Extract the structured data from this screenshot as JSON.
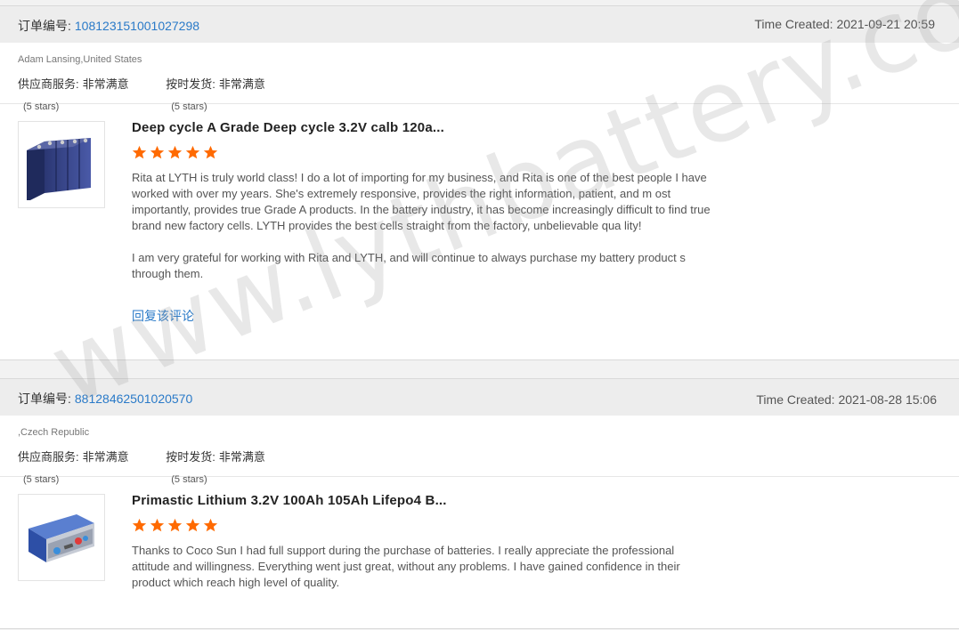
{
  "reviews": [
    {
      "order_label": "订单编号:",
      "order_number": "108123151001027298",
      "time_created": "Time Created: 2021-09-21 20:59",
      "buyer": "Adam Lansing,United States",
      "supplier_service_label": "供应商服务:",
      "supplier_service_value": "非常满意",
      "supplier_service_stars": "(5 stars)",
      "shipping_label": "按时发货:",
      "shipping_value": "非常满意",
      "shipping_stars": "(5 stars)",
      "product_title": "Deep cycle A Grade Deep cycle 3.2V calb 120a...",
      "rating": 5,
      "paragraphs": [
        "Rita at LYTH is truly world class! I do a lot of importing for my business, and Rita is one of the best people I have worked with over my years. She's extremely responsive, provides the right information, patient, and m ost importantly, provides true Grade A products. In the battery industry, it has become increasingly difficult to find true brand new factory cells. LYTH provides the best cells straight from the factory, unbelievable qua lity!",
        "I am very grateful for working with Rita and LYTH, and will continue to always purchase my battery product s through them."
      ],
      "reply_label": "回复该评论"
    },
    {
      "order_label": "订单编号:",
      "order_number": "88128462501020570",
      "time_created": "Time Created: 2021-08-28 15:06",
      "buyer": ",Czech Republic",
      "supplier_service_label": "供应商服务:",
      "supplier_service_value": "非常满意",
      "supplier_service_stars": "(5 stars)",
      "shipping_label": "按时发货:",
      "shipping_value": "非常满意",
      "shipping_stars": "(5 stars)",
      "product_title": "Primastic Lithium 3.2V 100Ah 105Ah Lifepo4 B...",
      "rating": 5,
      "paragraphs": [
        "Thanks to Coco Sun I had full support during the purchase of batteries. I really appreciate the professional attitude and willingness. Everything went just great, without any problems. I have gained confidence in their product which reach high level of quality."
      ]
    }
  ],
  "watermark": "www.lythbattery.com",
  "colors": {
    "link": "#2a7ac8",
    "star": "#ff6a00",
    "header_bg": "#ededed"
  }
}
